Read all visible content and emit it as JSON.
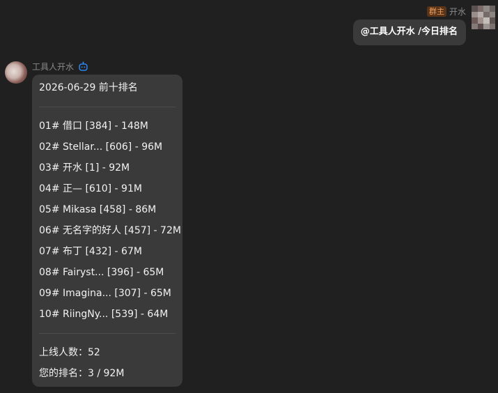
{
  "outgoing": {
    "role_badge": "群主",
    "sender_name": "开水",
    "message": "@工具人开水 /今日排名"
  },
  "incoming": {
    "sender_name": "工具人开水",
    "sender_icon": "bot-icon",
    "title": "2026-06-29 前十排名",
    "rankings": [
      "01# 借口 [384] - 148M",
      "02# Stellar... [606] - 96M",
      "03# 开水 [1] - 92M",
      "04# 正— [610] - 91M",
      "05# Mikasa [458] - 86M",
      "06# 无名字的好人 [457] - 72M",
      "07# 布丁 [432] - 67M",
      "08# Fairyst... [396] - 65M",
      "09# Imagina... [307] - 65M",
      "10# RiingNy... [539] - 64M"
    ],
    "online_count": "上线人数：52",
    "your_rank": "您的排名：3 / 92M"
  },
  "colors": {
    "background": "#202020",
    "bubble": "#3a3a3a",
    "badge_bg": "#5a3418",
    "badge_text": "#f0a060",
    "bot_icon": "#2f8cff"
  }
}
